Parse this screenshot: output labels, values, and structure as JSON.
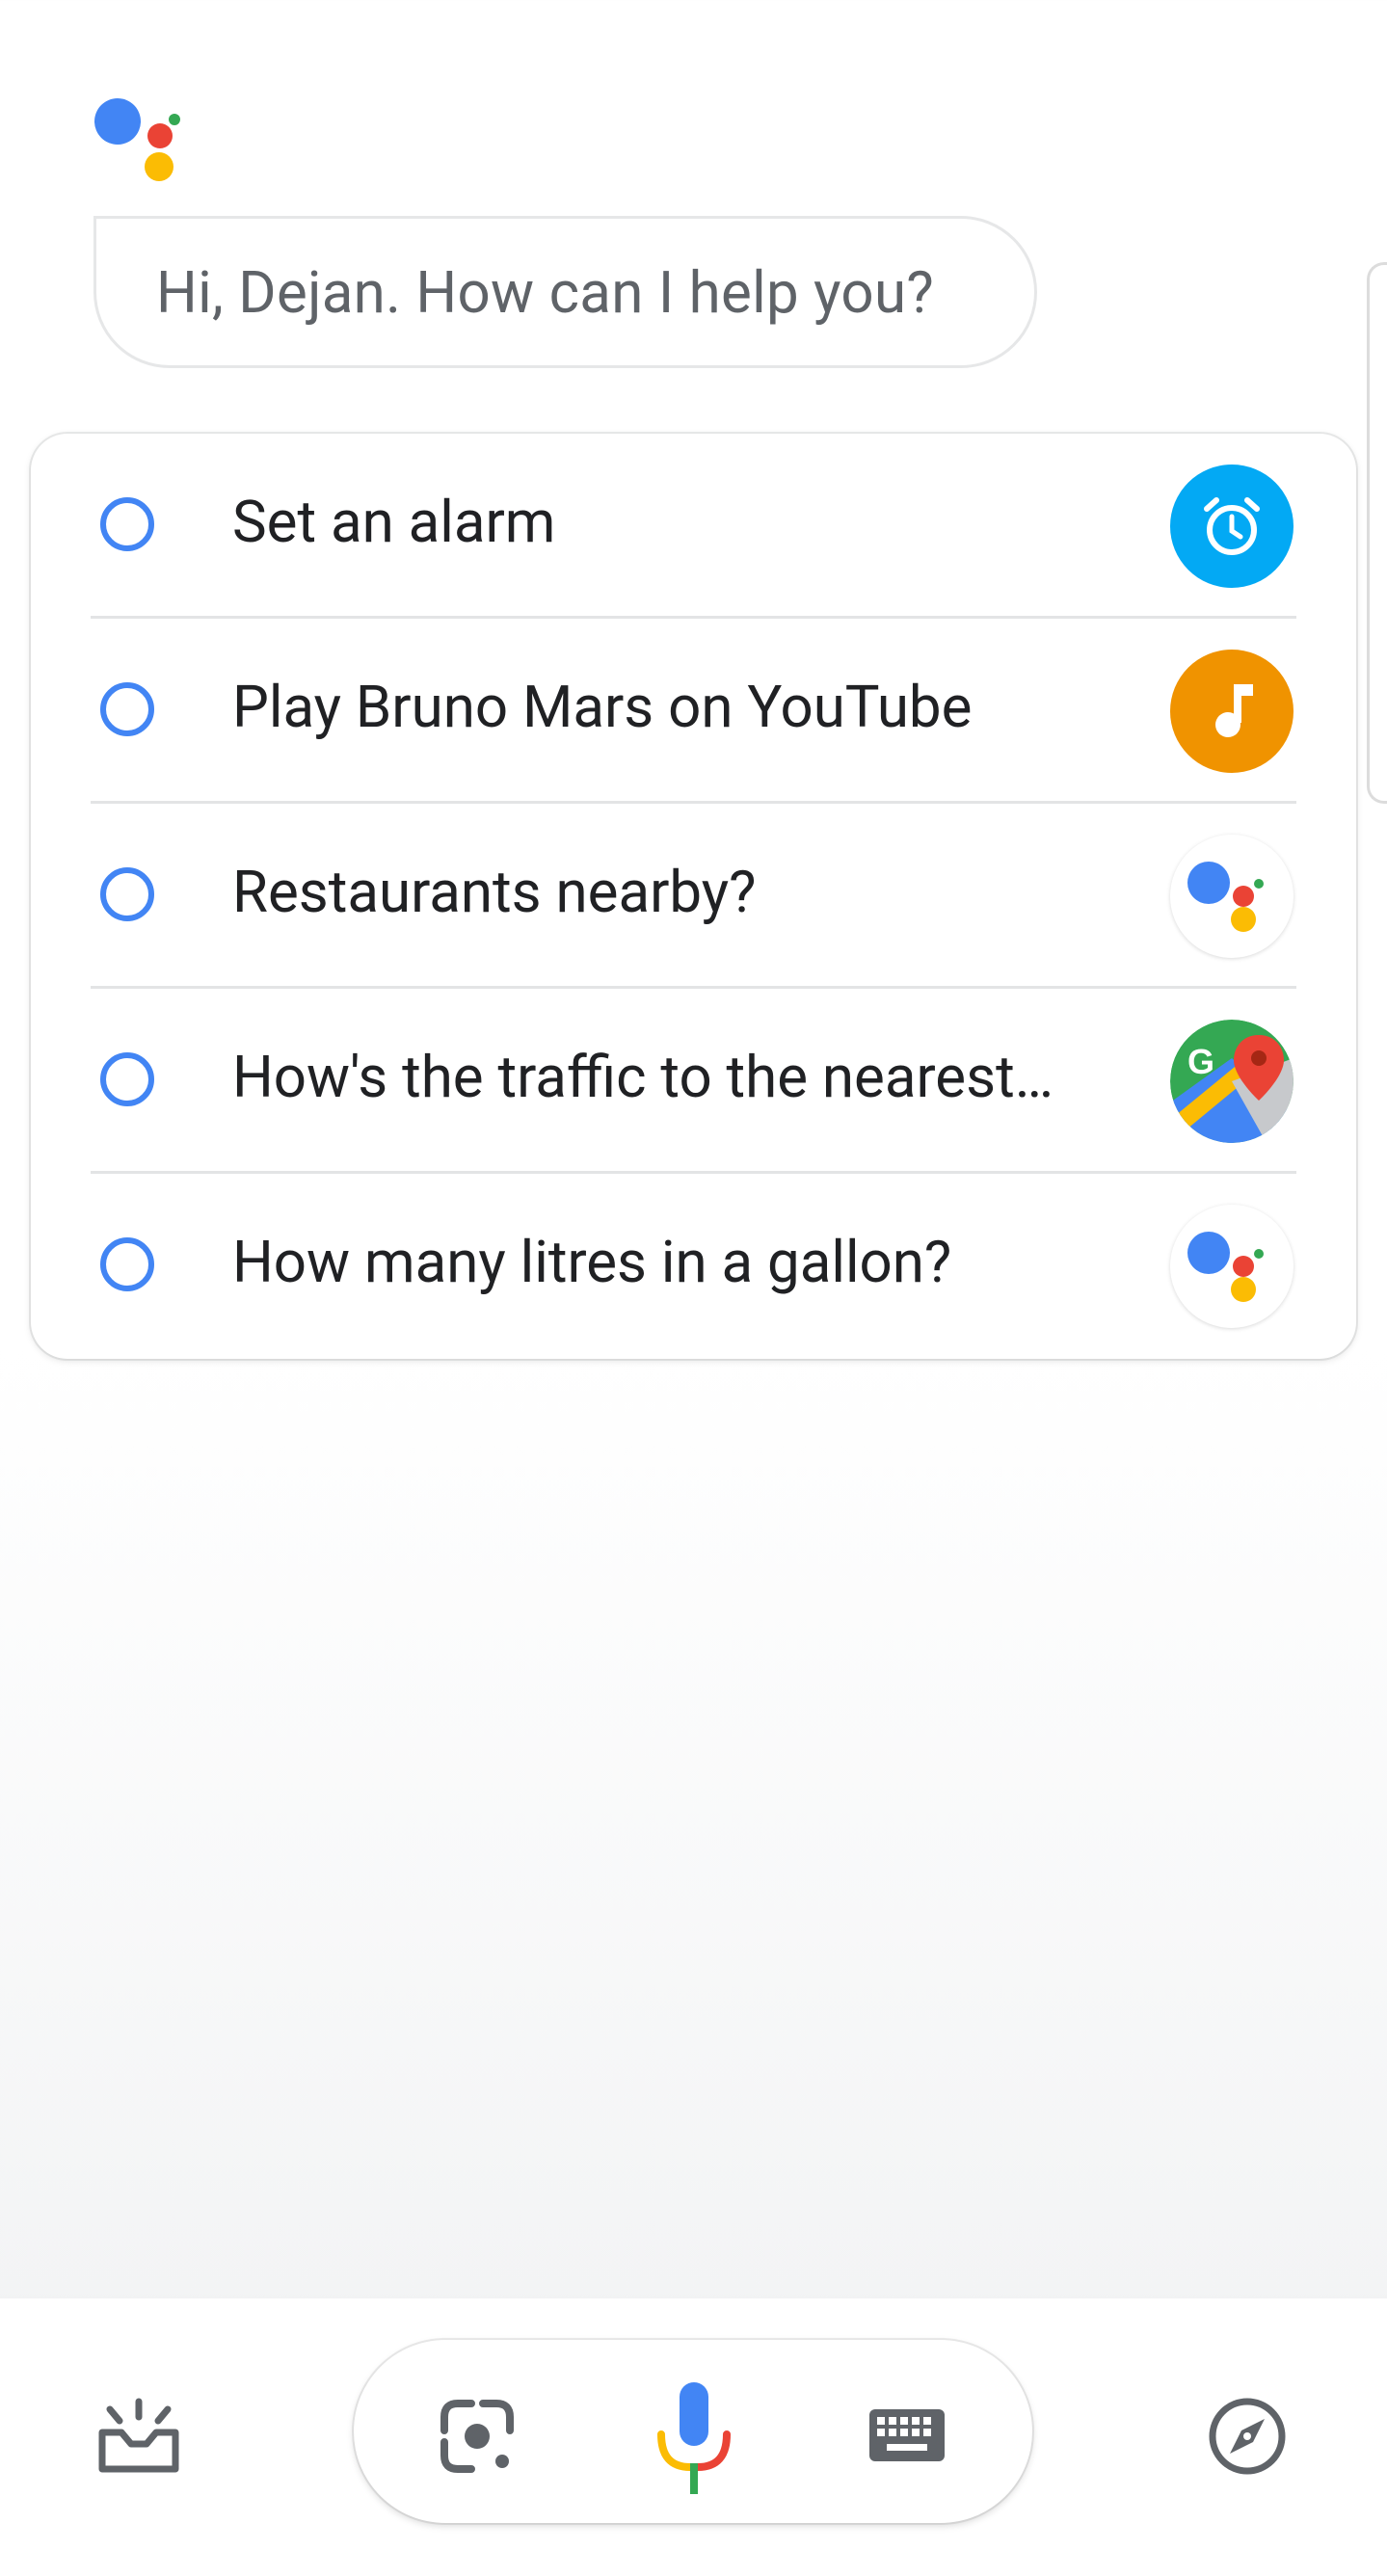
{
  "greeting": {
    "text": "Hi, Dejan. How can I help you?"
  },
  "suggestions": [
    {
      "label": "Set an alarm",
      "app_icon": "alarm-clock-icon",
      "color": "#03a9f4"
    },
    {
      "label": "Play Bruno Mars on YouTube",
      "app_icon": "music-note-icon",
      "color": "#f09300"
    },
    {
      "label": "Restaurants nearby?",
      "app_icon": "google-assistant-icon",
      "color": "#ffffff"
    },
    {
      "label": "How's the traffic to the nearest…",
      "app_icon": "google-maps-icon",
      "color": "#34a853"
    },
    {
      "label": "How many litres in a gallon?",
      "app_icon": "google-assistant-icon",
      "color": "#ffffff"
    }
  ],
  "bottom_bar": {
    "left_icon": "updates-tray-icon",
    "lens_icon": "google-lens-icon",
    "mic_icon": "microphone-icon",
    "keyboard_icon": "keyboard-icon",
    "right_icon": "explore-compass-icon"
  },
  "colors": {
    "blue": "#4285f4",
    "red": "#ea4335",
    "yellow": "#fbbc04",
    "green": "#34a853",
    "icon_gray": "#5f6368"
  }
}
